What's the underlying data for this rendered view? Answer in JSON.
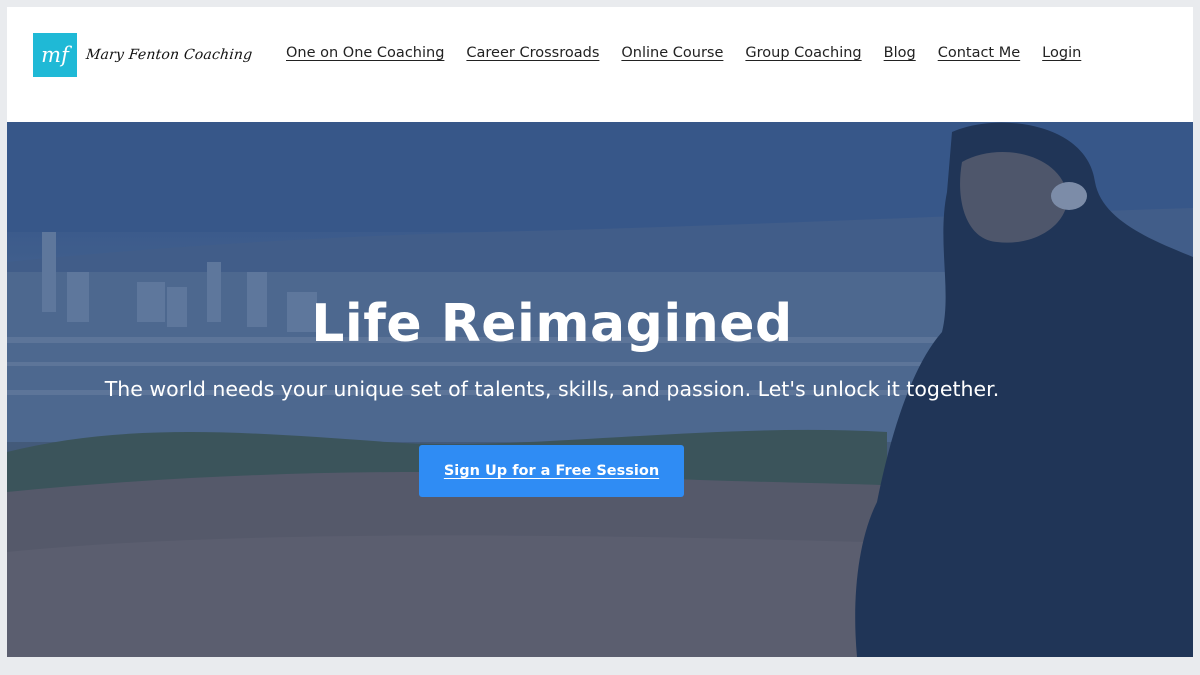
{
  "header": {
    "logo_text": "Mary Fenton Coaching",
    "logo_mark": "mf",
    "nav": [
      {
        "label": "One on One Coaching"
      },
      {
        "label": "Career Crossroads"
      },
      {
        "label": "Online Course"
      },
      {
        "label": "Group Coaching"
      },
      {
        "label": "Blog"
      },
      {
        "label": "Contact Me"
      },
      {
        "label": "Login"
      }
    ]
  },
  "hero": {
    "title": "Life Reimagined",
    "subtitle": "The world needs your unique set of talents, skills, and passion. Let's unlock it together.",
    "cta_label": "Sign Up for a Free Session"
  },
  "colors": {
    "logo_bg": "#1fb9d6",
    "cta_bg": "#2f8cf4",
    "page_bg": "#e9ebee"
  }
}
